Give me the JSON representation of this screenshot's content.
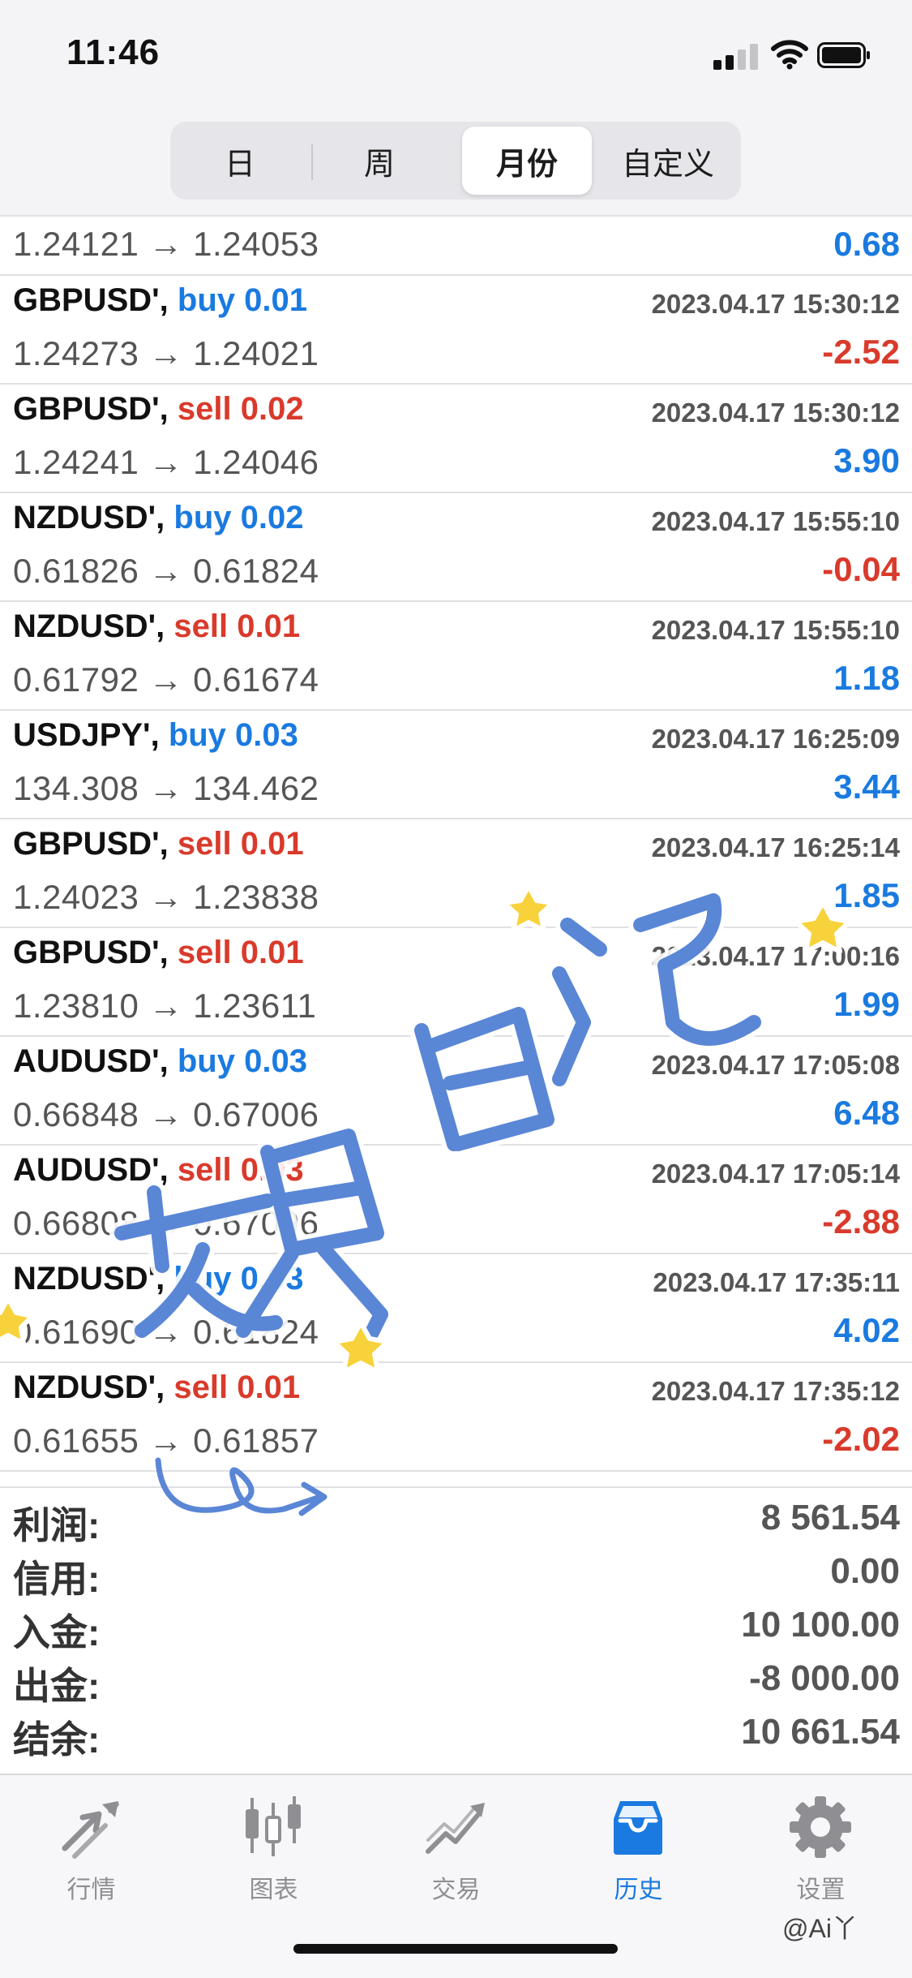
{
  "status": {
    "time": "11:46"
  },
  "segments": [
    "日",
    "周",
    "月份",
    "自定义"
  ],
  "active_segment": "月份",
  "partial_row": {
    "prices": "1.24121 → 1.24053",
    "profit": "0.68",
    "profit_sign": "pos"
  },
  "trades": [
    {
      "symbol": "GBPUSD',",
      "side": "buy",
      "side_label": "buy 0.01",
      "time": "2023.04.17 15:30:12",
      "prices": "1.24273 → 1.24021",
      "profit": "-2.52",
      "profit_sign": "neg"
    },
    {
      "symbol": "GBPUSD',",
      "side": "sell",
      "side_label": "sell 0.02",
      "time": "2023.04.17 15:30:12",
      "prices": "1.24241 → 1.24046",
      "profit": "3.90",
      "profit_sign": "pos"
    },
    {
      "symbol": "NZDUSD',",
      "side": "buy",
      "side_label": "buy 0.02",
      "time": "2023.04.17 15:55:10",
      "prices": "0.61826 → 0.61824",
      "profit": "-0.04",
      "profit_sign": "neg"
    },
    {
      "symbol": "NZDUSD',",
      "side": "sell",
      "side_label": "sell 0.01",
      "time": "2023.04.17 15:55:10",
      "prices": "0.61792 → 0.61674",
      "profit": "1.18",
      "profit_sign": "pos"
    },
    {
      "symbol": "USDJPY',",
      "side": "buy",
      "side_label": "buy 0.03",
      "time": "2023.04.17 16:25:09",
      "prices": "134.308 → 134.462",
      "profit": "3.44",
      "profit_sign": "pos"
    },
    {
      "symbol": "GBPUSD',",
      "side": "sell",
      "side_label": "sell 0.01",
      "time": "2023.04.17 16:25:14",
      "prices": "1.24023 → 1.23838",
      "profit": "1.85",
      "profit_sign": "pos"
    },
    {
      "symbol": "GBPUSD',",
      "side": "sell",
      "side_label": "sell 0.01",
      "time": "2023.04.17 17:00:16",
      "prices": "1.23810 → 1.23611",
      "profit": "1.99",
      "profit_sign": "pos"
    },
    {
      "symbol": "AUDUSD',",
      "side": "buy",
      "side_label": "buy 0.03",
      "time": "2023.04.17 17:05:08",
      "prices": "0.66848 → 0.67006",
      "profit": "6.48",
      "profit_sign": "pos"
    },
    {
      "symbol": "AUDUSD',",
      "side": "sell",
      "side_label": "sell 0.03",
      "time": "2023.04.17 17:05:14",
      "prices": "0.66808 → 0.67096",
      "profit": "-2.88",
      "profit_sign": "neg"
    },
    {
      "symbol": "NZDUSD',",
      "side": "buy",
      "side_label": "buy 0.03",
      "time": "2023.04.17 17:35:11",
      "prices": "0.61690 → 0.61824",
      "profit": "4.02",
      "profit_sign": "pos"
    },
    {
      "symbol": "NZDUSD',",
      "side": "sell",
      "side_label": "sell 0.01",
      "time": "2023.04.17 17:35:12",
      "prices": "0.61655 → 0.61857",
      "profit": "-2.02",
      "profit_sign": "neg"
    }
  ],
  "summary": [
    {
      "label": "利润:",
      "value": "8 561.54"
    },
    {
      "label": "信用:",
      "value": "0.00"
    },
    {
      "label": "入金:",
      "value": "10 100.00"
    },
    {
      "label": "出金:",
      "value": "-8 000.00"
    },
    {
      "label": "结余:",
      "value": "10 661.54"
    }
  ],
  "tabs": [
    {
      "label": "行情",
      "icon": "quotes-arrows-icon"
    },
    {
      "label": "图表",
      "icon": "candlestick-chart-icon"
    },
    {
      "label": "交易",
      "icon": "trade-chart-icon"
    },
    {
      "label": "历史",
      "icon": "history-inbox-icon"
    },
    {
      "label": "设置",
      "icon": "gear-icon"
    }
  ],
  "active_tab": "历史",
  "overlay": {
    "sticker_text": "交易日记",
    "credit": "@Ai丫"
  },
  "colors": {
    "buy": "#1a7ae0",
    "sell": "#d93a2b",
    "active_tab": "#1a7ae0",
    "sticker": "#5a86d6",
    "star": "#f7d23a"
  }
}
